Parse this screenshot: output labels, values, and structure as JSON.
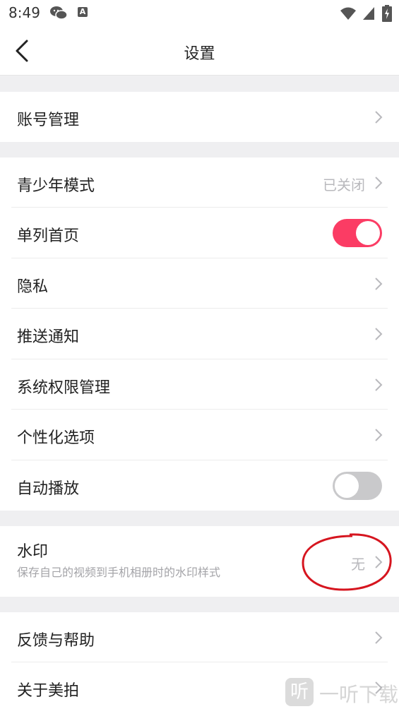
{
  "status_bar": {
    "time": "8:49",
    "icons": [
      "wechat-icon",
      "a-notification-icon",
      "wifi-icon",
      "signal-icon",
      "battery-icon"
    ],
    "a_icon_letter": "A"
  },
  "header": {
    "title": "设置",
    "back_icon": "chevron-left-icon"
  },
  "colors": {
    "accent": "#fb3c64",
    "toggle_off": "#c9c9cb",
    "annotation": "#d6151f",
    "section_gap": "#efeff1"
  },
  "sections": {
    "account": {
      "label": "账号管理"
    },
    "teen_mode": {
      "label": "青少年模式",
      "value": "已关闭"
    },
    "single_column": {
      "label": "单列首页",
      "toggle": "on"
    },
    "privacy": {
      "label": "隐私"
    },
    "push": {
      "label": "推送通知"
    },
    "permissions": {
      "label": "系统权限管理"
    },
    "personalization": {
      "label": "个性化选项"
    },
    "autoplay": {
      "label": "自动播放",
      "toggle": "off"
    },
    "watermark": {
      "label": "水印",
      "description": "保存自己的视频到手机相册时的水印样式",
      "value": "无"
    },
    "feedback": {
      "label": "反馈与帮助"
    },
    "about": {
      "label": "关于美拍"
    }
  },
  "site_watermark": {
    "logo_char": "听",
    "text": "一听下载"
  }
}
